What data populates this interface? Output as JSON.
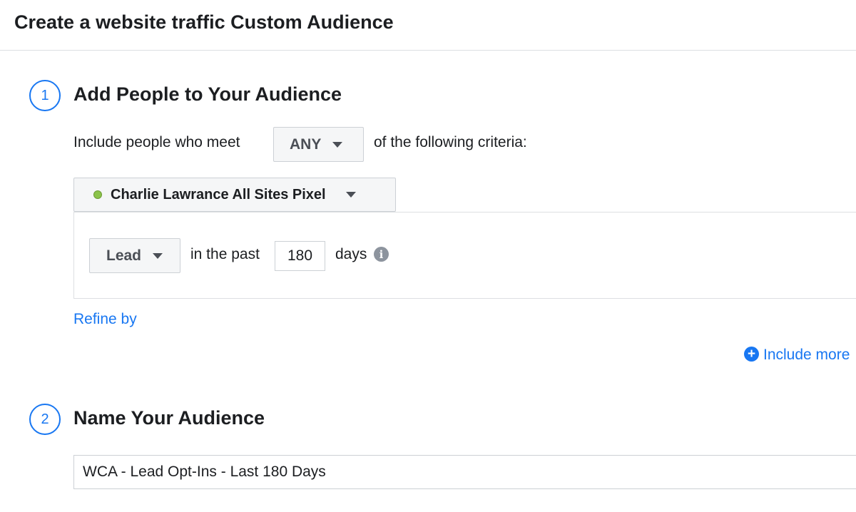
{
  "header": {
    "title": "Create a website traffic Custom Audience"
  },
  "step1": {
    "number": "1",
    "title": "Add People to Your Audience",
    "include_prefix": "Include people who meet",
    "match_selector": "ANY",
    "include_suffix": "of the following criteria:",
    "pixel": {
      "name": "Charlie Lawrance All Sites Pixel",
      "status_color": "#8bc34a"
    },
    "rule": {
      "event": "Lead",
      "in_the_past_label": "in the past",
      "days_value": "180",
      "days_label": "days",
      "info_icon": "info-icon"
    },
    "refine_by": "Refine by",
    "include_more": "Include more"
  },
  "step2": {
    "number": "2",
    "title": "Name Your Audience",
    "audience_name_value": "WCA - Lead Opt-Ins - Last 180 Days"
  },
  "colors": {
    "accent": "#1877f2",
    "text": "#1c1e21",
    "border": "#ccd0d5"
  }
}
